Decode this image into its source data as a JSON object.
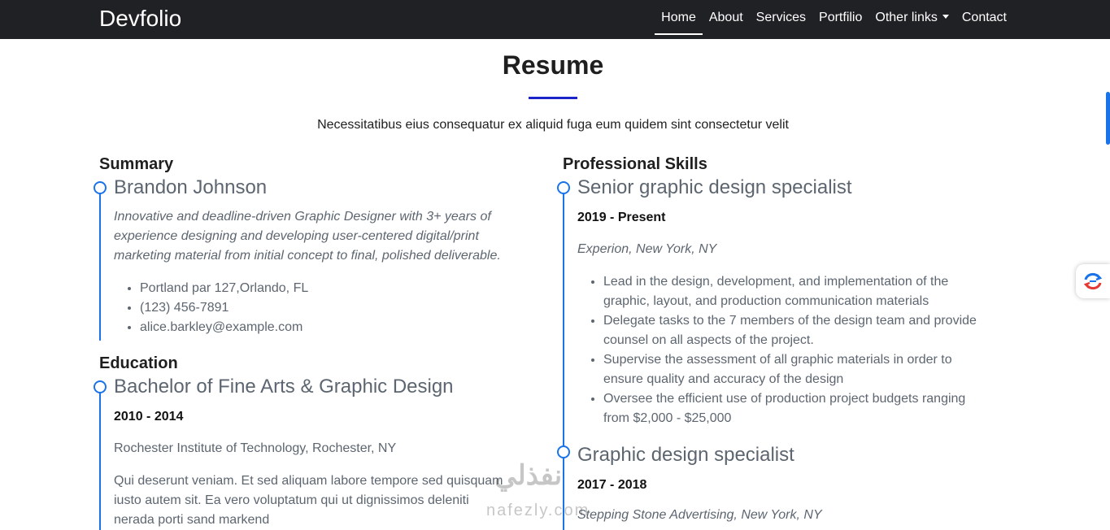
{
  "nav": {
    "brand": "Devfolio",
    "links": [
      "Home",
      "About",
      "Services",
      "Portfilio",
      "Other links",
      "Contact"
    ]
  },
  "section": {
    "title": "Resume",
    "subtitle": "Necessitatibus eius consequatur ex aliquid fuga eum quidem sint consectetur velit"
  },
  "summary": {
    "heading": "Summary",
    "name": "Brandon Johnson",
    "description": "Innovative and deadline-driven Graphic Designer with 3+ years of experience designing and developing user-centered digital/print marketing material from initial concept to final, polished deliverable.",
    "contacts": [
      "Portland par 127,Orlando, FL",
      "(123) 456-7891",
      "alice.barkley@example.com"
    ]
  },
  "education": {
    "heading": "Education",
    "degree": "Bachelor of Fine Arts & Graphic Design",
    "years": "2010 - 2014",
    "school": "Rochester Institute of Technology, Rochester, NY",
    "text": "Qui deserunt veniam. Et sed aliquam labore tempore sed quisquam iusto autem sit. Ea vero voluptatum qui ut dignissimos deleniti nerada porti sand markend"
  },
  "skills": {
    "heading": "Professional Skills",
    "jobs": [
      {
        "title": "Senior graphic design specialist",
        "years": "2019 - Present",
        "company": "Experion, New York, NY",
        "bullets": [
          "Lead in the design, development, and implementation of the graphic, layout, and production communication materials",
          "Delegate tasks to the 7 members of the design team and provide counsel on all aspects of the project.",
          "Supervise the assessment of all graphic materials in order to ensure quality and accuracy of the design",
          "Oversee the efficient use of production project budgets ranging from $2,000 - $25,000"
        ]
      },
      {
        "title": "Graphic design specialist",
        "years": "2017 - 2018",
        "company": "Stepping Stone Advertising, New York, NY"
      }
    ]
  },
  "watermark": {
    "script": "نفذلي",
    "text": "nafezly.com"
  },
  "colors": {
    "navbar": "#202124",
    "accent": "#1a73e8",
    "title_underline": "#1a24c7"
  }
}
